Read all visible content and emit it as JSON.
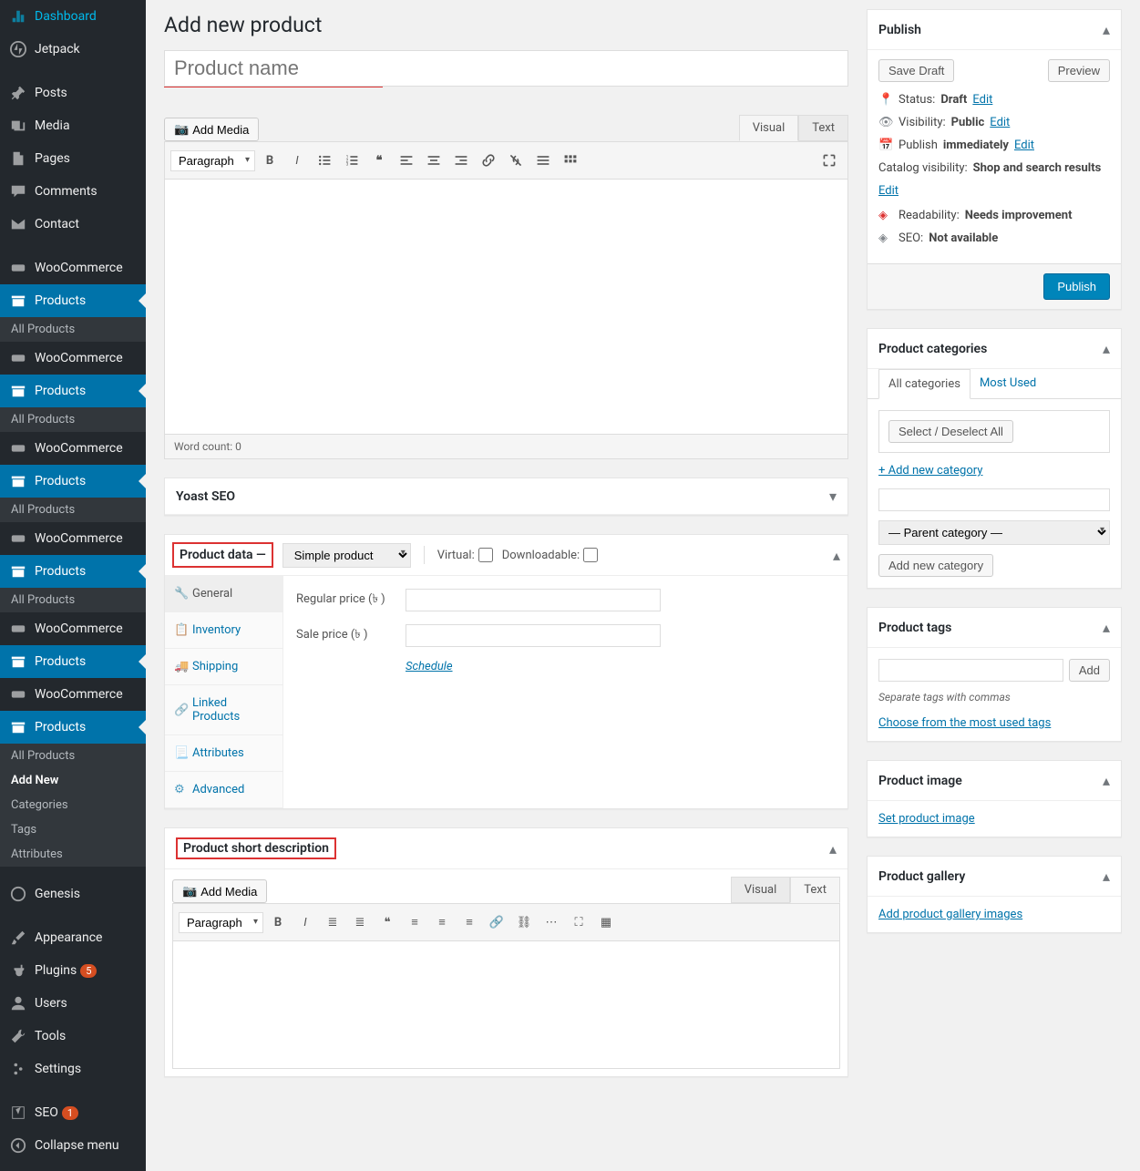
{
  "sidebar": {
    "dashboard": "Dashboard",
    "jetpack": "Jetpack",
    "posts": "Posts",
    "media": "Media",
    "pages": "Pages",
    "comments": "Comments",
    "contact": "Contact",
    "woocommerce": "WooCommerce",
    "products": "Products",
    "all_products": "All Products",
    "add_new": "Add New",
    "categories": "Categories",
    "tags": "Tags",
    "attributes": "Attributes",
    "genesis": "Genesis",
    "appearance": "Appearance",
    "plugins": "Plugins",
    "plugins_count": "5",
    "users": "Users",
    "tools": "Tools",
    "settings": "Settings",
    "seo": "SEO",
    "seo_count": "1",
    "collapse": "Collapse menu"
  },
  "page": {
    "title": "Add new product"
  },
  "title_input": {
    "placeholder": "Product name"
  },
  "editor": {
    "add_media": "Add Media",
    "visual": "Visual",
    "text": "Text",
    "paragraph": "Paragraph",
    "word_count": "Word count: 0"
  },
  "yoast": {
    "title": "Yoast SEO"
  },
  "product_data": {
    "title": "Product data —",
    "type": "Simple product",
    "virtual": "Virtual:",
    "downloadable": "Downloadable:",
    "tabs": {
      "general": "General",
      "inventory": "Inventory",
      "shipping": "Shipping",
      "linked": "Linked Products",
      "attributes": "Attributes",
      "advanced": "Advanced"
    },
    "regular_price": "Regular price (৳ )",
    "sale_price": "Sale price (৳ )",
    "schedule": "Schedule"
  },
  "short_desc": {
    "title": "Product short description"
  },
  "publish": {
    "title": "Publish",
    "save_draft": "Save Draft",
    "preview": "Preview",
    "status_label": "Status:",
    "status": "Draft",
    "edit": "Edit",
    "visibility_label": "Visibility:",
    "visibility": "Public",
    "publish_label": "Publish",
    "immediately": "immediately",
    "catalog_label": "Catalog visibility:",
    "catalog": "Shop and search results",
    "readability_label": "Readability:",
    "readability": "Needs improvement",
    "seo_label": "SEO:",
    "seo": "Not available",
    "publish_btn": "Publish"
  },
  "categories": {
    "title": "Product categories",
    "all": "All categories",
    "most_used": "Most Used",
    "select_all": "Select / Deselect All",
    "add_new": "+ Add new category",
    "parent": "— Parent category —",
    "add_btn": "Add new category"
  },
  "tags": {
    "title": "Product tags",
    "add": "Add",
    "hint": "Separate tags with commas",
    "choose": "Choose from the most used tags"
  },
  "image": {
    "title": "Product image",
    "set": "Set product image"
  },
  "gallery": {
    "title": "Product gallery",
    "add": "Add product gallery images"
  }
}
